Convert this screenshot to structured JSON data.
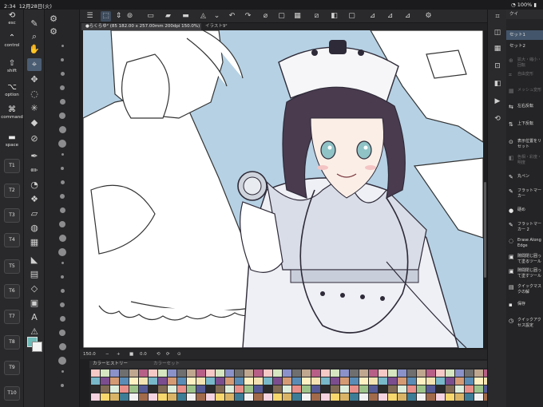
{
  "status": {
    "time": "2:34",
    "date": "12月28日(火)",
    "battery": "100%"
  },
  "modifiers": [
    {
      "glyph": "⟲",
      "label": "esc"
    },
    {
      "glyph": "⌃",
      "label": "control"
    },
    {
      "glyph": "⇧",
      "label": "shift"
    },
    {
      "glyph": "⌥",
      "label": "option"
    },
    {
      "glyph": "⌘",
      "label": "command"
    },
    {
      "glyph": "▬",
      "label": "space"
    }
  ],
  "fkeys": [
    "T1",
    "T2",
    "T3",
    "T4",
    "T5",
    "T6",
    "T7",
    "T8",
    "T9",
    "T10"
  ],
  "tabs": [
    {
      "label": "●らくらゆ² (85 182.00 x 257.00mm 200dpi 150.0%)"
    },
    {
      "label": "イラスト9²"
    }
  ],
  "navigator": {
    "zoom": "150.0",
    "rotation": "0.0"
  },
  "color_panel": {
    "history_tab": "カラーヒストリー",
    "set_tab": "カラーセット"
  },
  "right_panel": {
    "header": "クイ",
    "sets": [
      "セット1",
      "セット2"
    ],
    "actions": [
      {
        "icon": "⊕",
        "label": "拡大・縮小・回転",
        "enabled": false
      },
      {
        "icon": "⌗",
        "label": "自由変形",
        "enabled": false
      },
      {
        "icon": "▦",
        "label": "メッシュ変形",
        "enabled": false
      },
      {
        "icon": "⇆",
        "label": "左右反転",
        "enabled": true
      },
      {
        "icon": "⇅",
        "label": "上下反転",
        "enabled": true
      },
      {
        "icon": "⊙",
        "label": "表示位置をリセット",
        "enabled": true
      },
      {
        "icon": "◧",
        "label": "色相・彩度・明度",
        "enabled": false
      },
      {
        "icon": "✎",
        "label": "丸ペン",
        "enabled": true
      },
      {
        "icon": "✎",
        "label": "フラットマーカー",
        "enabled": true
      },
      {
        "icon": "●",
        "label": "硬め",
        "enabled": true
      },
      {
        "icon": "✎",
        "label": "フラットマーカー 2",
        "enabled": true
      },
      {
        "icon": "◌",
        "label": "Erase Along Edge",
        "enabled": true
      },
      {
        "icon": "▣",
        "label": "隙間閉じ囲って塗るツール",
        "enabled": true
      },
      {
        "icon": "▣",
        "label": "隙間閉じ囲って塗すツール",
        "enabled": true
      },
      {
        "icon": "▤",
        "label": "クイックマスクの解",
        "enabled": true
      },
      {
        "icon": "▪",
        "label": "保存",
        "enabled": true
      },
      {
        "icon": "◷",
        "label": "クイックアクセス設定",
        "enabled": true
      }
    ]
  },
  "colors": {
    "canvas_bg": "#b6d1e4",
    "hair": "#4a3b4f",
    "eye": "#8fc3c6",
    "accent": "#43556a",
    "fg_swatch": "#6ebab8"
  }
}
